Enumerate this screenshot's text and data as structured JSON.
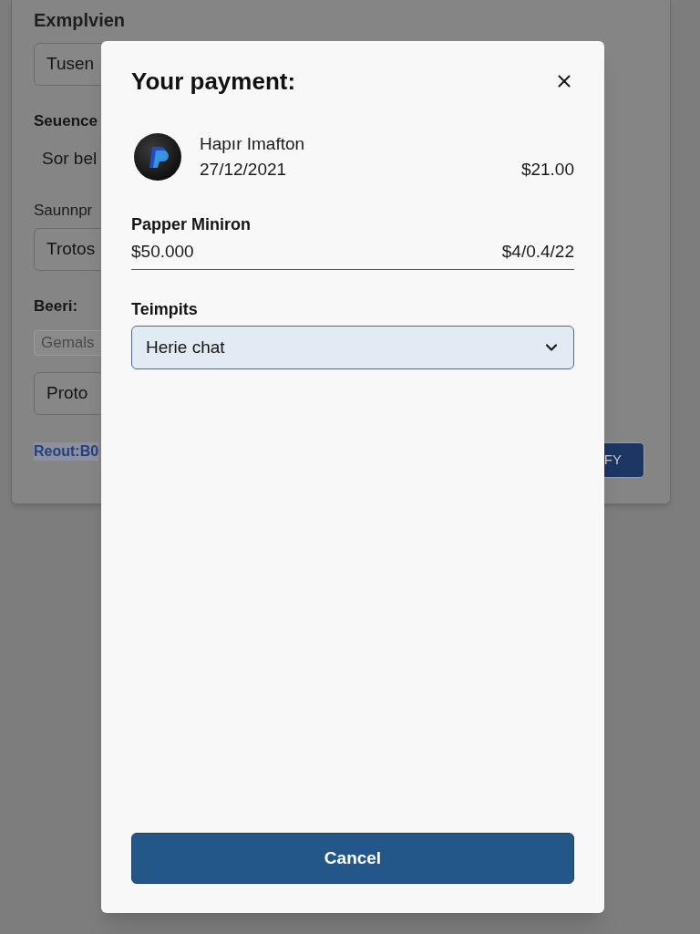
{
  "background_form": {
    "heading": "Exmplvien",
    "items": [
      {
        "kind": "input",
        "value": "Tusen"
      },
      {
        "kind": "label",
        "text": "Seuence"
      },
      {
        "kind": "text",
        "text": "Sor bel"
      },
      {
        "kind": "caption",
        "text": "Saunnpr"
      },
      {
        "kind": "input",
        "value": "Trotos"
      },
      {
        "kind": "label",
        "text": "Beeri:"
      },
      {
        "kind": "small_input",
        "placeholder": "Gemals"
      },
      {
        "kind": "input",
        "value": "Proto"
      }
    ],
    "link": "Reout:B0",
    "button": "FY"
  },
  "dialog": {
    "title": "Your payment:",
    "payment": {
      "name": "Hapır Imafton",
      "date": "27/12/2021",
      "amount": "$21.00"
    },
    "section": {
      "title": "Papper Miniron",
      "amount": "$50.000",
      "column_2": "$4/0.4/22"
    },
    "select": {
      "label": "Teimpits",
      "value": "Herie chat"
    },
    "buttons": [
      {
        "label": "Cancel"
      }
    ]
  }
}
